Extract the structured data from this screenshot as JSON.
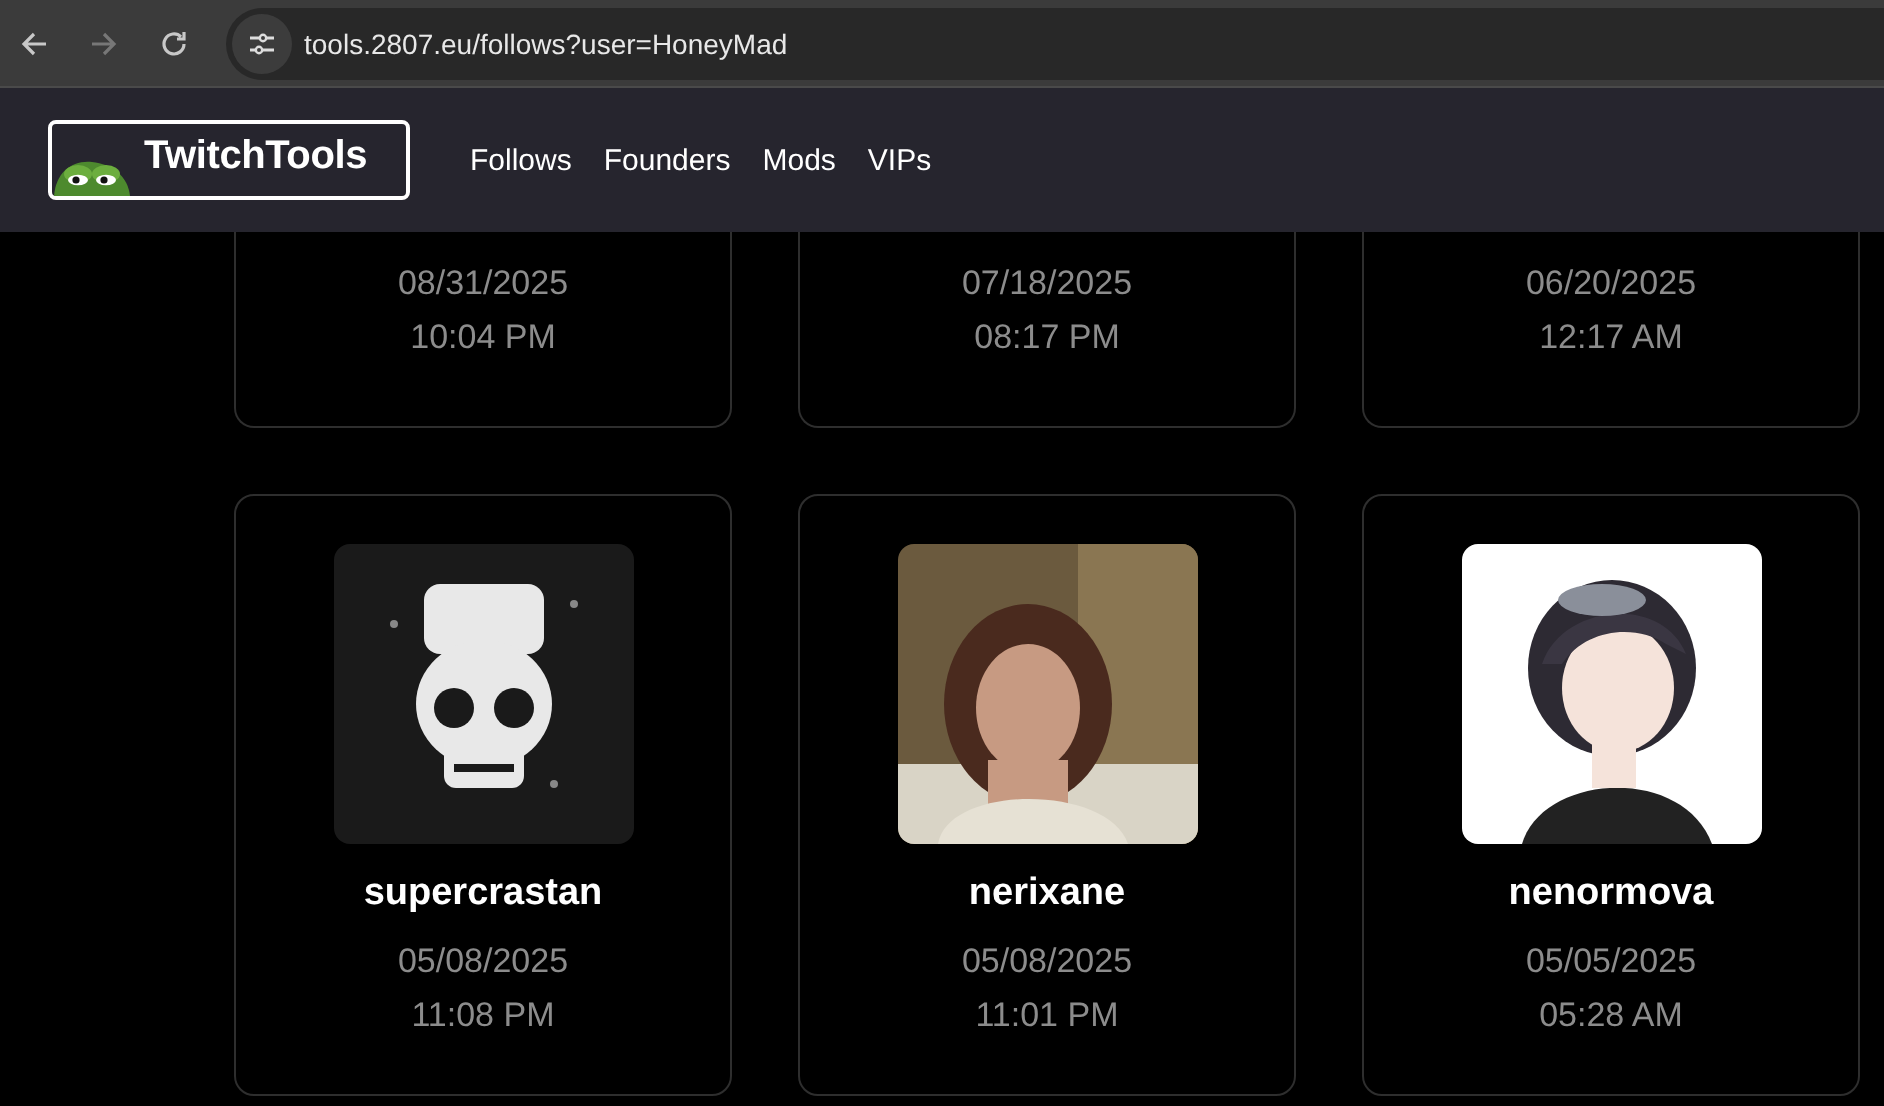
{
  "browser": {
    "url": "tools.2807.eu/follows?user=HoneyMad",
    "forward_disabled": true
  },
  "header": {
    "logo": "TwitchTools",
    "nav": [
      "Follows",
      "Founders",
      "Mods",
      "VIPs"
    ]
  },
  "cards": [
    {
      "date": "08/31/2025",
      "time": "10:04 PM"
    },
    {
      "date": "07/18/2025",
      "time": "08:17 PM"
    },
    {
      "date": "06/20/2025",
      "time": "12:17 AM"
    },
    {
      "name": "supercrastan",
      "date": "05/08/2025",
      "time": "11:08 PM",
      "avatar": {
        "kind": "dark"
      }
    },
    {
      "name": "nerixane",
      "date": "05/08/2025",
      "time": "11:01 PM"
    },
    {
      "name": "nenormova",
      "date": "05/05/2025",
      "time": "05:28 AM",
      "avatar": {
        "kind": "light"
      }
    }
  ]
}
